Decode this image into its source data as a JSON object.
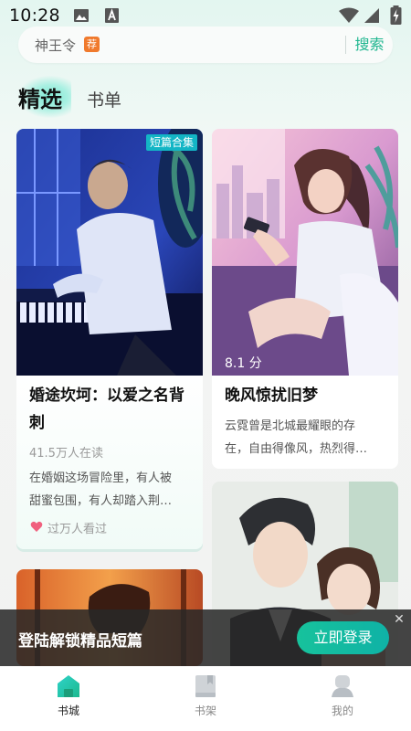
{
  "status_bar": {
    "time": "10:28"
  },
  "search": {
    "query": "神王令",
    "tag": "荐",
    "button_label": "搜索"
  },
  "tabs": [
    {
      "label": "精选"
    },
    {
      "label": "书单"
    }
  ],
  "cards": [
    {
      "badge": "短篇合集",
      "title_line1": "婚途坎坷：以爱之名背",
      "title_line2": "刺",
      "readers": "41.5万人在读",
      "desc_line1": "在婚姻这场冒险里，有人被",
      "desc_line2": "甜蜜包围，有人却踏入荆…",
      "footer": "过万人看过"
    },
    {
      "score": "8.1 分",
      "title": "晚风惊扰旧梦",
      "desc_line1": "云霓曾是北城最耀眼的存",
      "desc_line2": "在，自由得像风，热烈得…"
    }
  ],
  "login_banner": {
    "text": "登陆解锁精品短篇",
    "button_label": "立即登录"
  },
  "bottom_nav": [
    {
      "label": "书城",
      "icon": "bookstore-icon",
      "active": true
    },
    {
      "label": "书架",
      "icon": "bookshelf-icon",
      "active": false
    },
    {
      "label": "我的",
      "icon": "profile-icon",
      "active": false
    }
  ],
  "colors": {
    "accent": "#1fb68f",
    "badge": "#13b5c5",
    "tag": "#f07a2d"
  }
}
